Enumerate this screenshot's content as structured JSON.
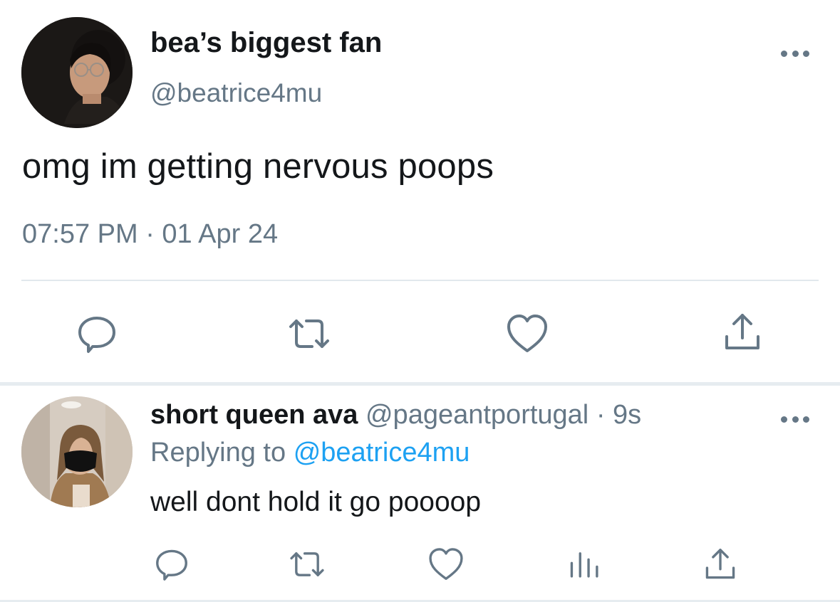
{
  "main_tweet": {
    "display_name": "bea’s biggest fan",
    "handle": "@beatrice4mu",
    "text": "omg im getting nervous poops",
    "timestamp": "07:57 PM · 01 Apr 24"
  },
  "reply": {
    "display_name": "short queen ava",
    "handle": "@pageantportugal",
    "age": "· 9s",
    "replying_prefix": "Replying to",
    "replying_to": "@beatrice4mu",
    "text": "well dont hold it go poooop"
  },
  "icons": {
    "more": "more-horizontal-icon",
    "reply": "comment-bubble-icon",
    "retweet": "retweet-icon",
    "like": "heart-icon",
    "share": "share-upload-icon",
    "stats": "bar-chart-icon"
  },
  "colors": {
    "text": "#14171a",
    "secondary": "#657786",
    "link": "#1da1f2",
    "divider": "#e1e8ed"
  }
}
